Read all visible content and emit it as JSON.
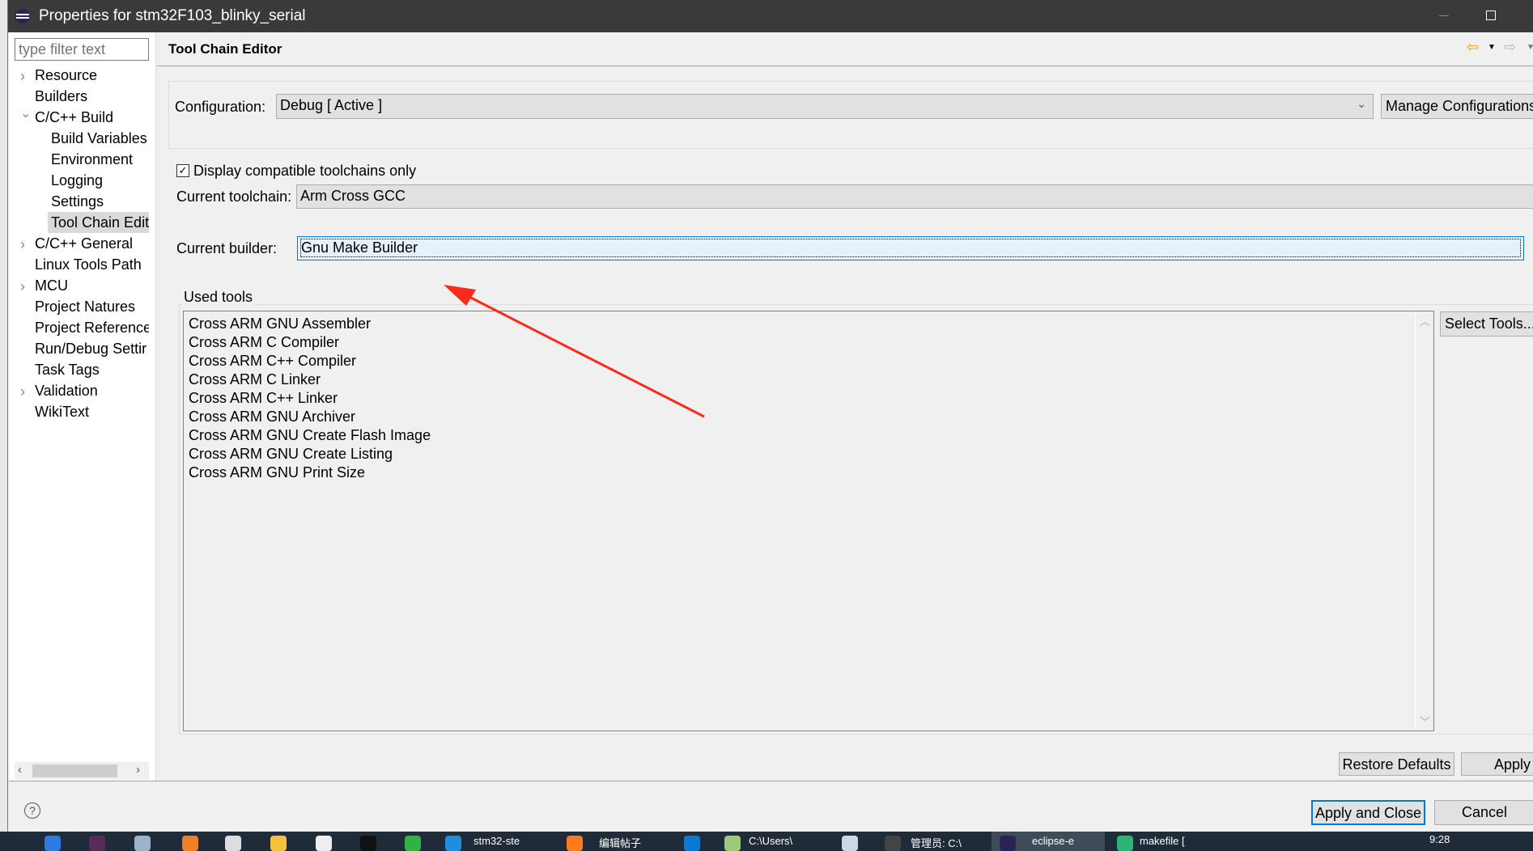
{
  "window": {
    "title": "Properties for stm32F103_blinky_serial"
  },
  "sidebar": {
    "filter_placeholder": "type filter text",
    "items": [
      {
        "label": "Resource",
        "expander": "collapsed",
        "level": 0
      },
      {
        "label": "Builders",
        "expander": "none",
        "level": 0
      },
      {
        "label": "C/C++ Build",
        "expander": "expanded",
        "level": 0
      },
      {
        "label": "Build Variables",
        "expander": "none",
        "level": 1
      },
      {
        "label": "Environment",
        "expander": "none",
        "level": 1
      },
      {
        "label": "Logging",
        "expander": "none",
        "level": 1
      },
      {
        "label": "Settings",
        "expander": "none",
        "level": 1
      },
      {
        "label": "Tool Chain Edit",
        "expander": "none",
        "level": 1,
        "selected": true
      },
      {
        "label": "C/C++ General",
        "expander": "collapsed",
        "level": 0
      },
      {
        "label": "Linux Tools Path",
        "expander": "none",
        "level": 0
      },
      {
        "label": "MCU",
        "expander": "collapsed",
        "level": 0
      },
      {
        "label": "Project Natures",
        "expander": "none",
        "level": 0
      },
      {
        "label": "Project Reference",
        "expander": "none",
        "level": 0
      },
      {
        "label": "Run/Debug Settir",
        "expander": "none",
        "level": 0
      },
      {
        "label": "Task Tags",
        "expander": "none",
        "level": 0
      },
      {
        "label": "Validation",
        "expander": "collapsed",
        "level": 0
      },
      {
        "label": "WikiText",
        "expander": "none",
        "level": 0
      }
    ]
  },
  "main": {
    "title": "Tool Chain Editor",
    "config_label": "Configuration:",
    "config_value": "Debug  [ Active ]",
    "manage_label": "Manage Configurations...",
    "compat_checkbox": {
      "label": "Display compatible toolchains only",
      "checked": true
    },
    "toolchain_label": "Current toolchain:",
    "toolchain_value": "Arm Cross GCC",
    "builder_label": "Current builder:",
    "builder_value": "Gnu Make Builder",
    "used_tools_label": "Used tools",
    "used_tools": [
      "Cross ARM GNU Assembler",
      "Cross ARM C Compiler",
      "Cross ARM C++ Compiler",
      "Cross ARM C Linker",
      "Cross ARM C++ Linker",
      "Cross ARM GNU Archiver",
      "Cross ARM GNU Create Flash Image",
      "Cross ARM GNU Create Listing",
      "Cross ARM GNU Print Size"
    ],
    "select_tools_label": "Select Tools...",
    "restore_label": "Restore Defaults",
    "apply_label": "Apply"
  },
  "footer": {
    "apply_close_label": "Apply and Close",
    "cancel_label": "Cancel"
  },
  "annotation_color": "#ff2a1a",
  "taskbar": {
    "items": [
      "stm32-ste",
      "编辑帖子",
      "C:\\Users\\",
      "管理员: C:\\",
      "eclipse-e",
      "makefile ["
    ],
    "time": "9:28"
  }
}
